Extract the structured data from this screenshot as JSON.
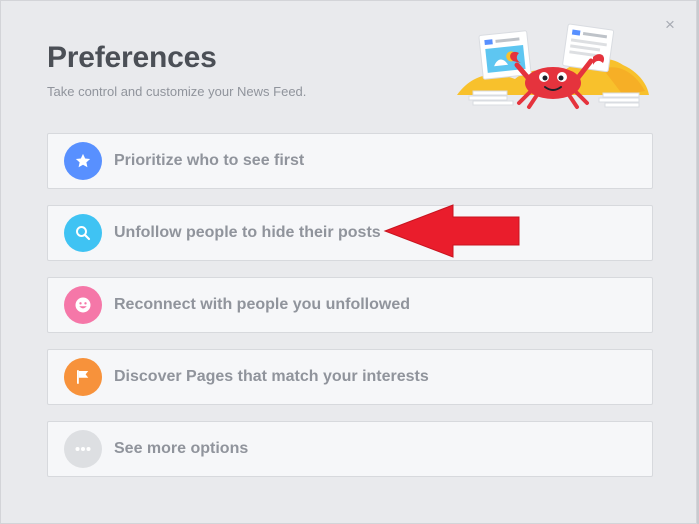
{
  "dialog": {
    "title": "Preferences",
    "subtitle": "Take control and customize your News Feed.",
    "close_symbol": "×"
  },
  "options": [
    {
      "label": "Prioritize who to see first",
      "icon": "star-icon",
      "color": "#5890ff"
    },
    {
      "label": "Unfollow people to hide their posts",
      "icon": "search-icon",
      "color": "#3fc3f3"
    },
    {
      "label": "Reconnect with people you unfollowed",
      "icon": "smiley-icon",
      "color": "#f577a8"
    },
    {
      "label": "Discover Pages that match your interests",
      "icon": "flag-icon",
      "color": "#f7923b"
    },
    {
      "label": "See more options",
      "icon": "more-icon",
      "color": "#dddfe2"
    }
  ],
  "annotation": {
    "arrow_color": "#ea1d2c"
  }
}
